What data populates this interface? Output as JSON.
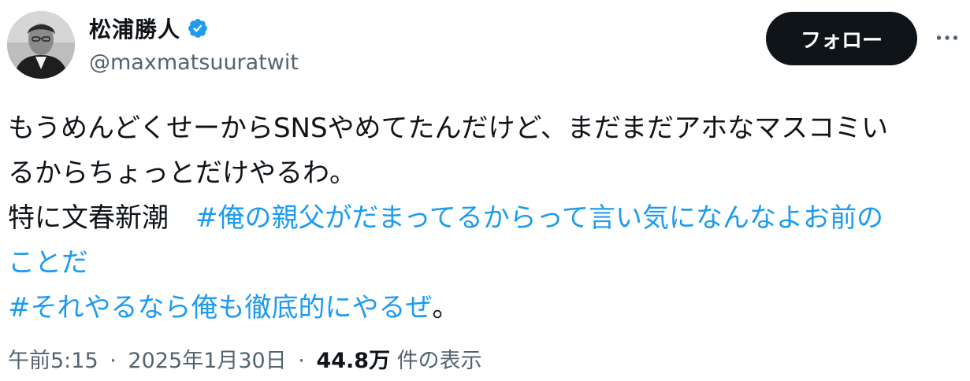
{
  "author": {
    "display_name": "松浦勝人",
    "handle": "@maxmatsuuratwit",
    "verified": true,
    "avatar_icon": "profile-photo-avatar"
  },
  "actions": {
    "follow_label": "フォロー",
    "more_icon": "more-horizontal-icon"
  },
  "tweet": {
    "line1": "もうめんどくせーからSNSやめてたんだけど、まだまだアホなマスコミい",
    "line2": "るからちょっとだけやるわ。",
    "line3_prefix": "特に文春新潮",
    "hashtag1_part1": "#俺の親父がだまってるからって言い気になんなよお前の",
    "hashtag1_part2": "ことだ",
    "hashtag2": "#それやるなら俺も徹底的にやるぜ",
    "line5_suffix": "。"
  },
  "meta": {
    "time": "午前5:15",
    "separator": "·",
    "date": "2025年1月30日",
    "views_count": "44.8万",
    "views_label": "件の表示"
  },
  "colors": {
    "text": "#0f1419",
    "secondary": "#536471",
    "link": "#1d9bf0",
    "follow_bg": "#0f1419",
    "verified": "#1d9bf0"
  }
}
